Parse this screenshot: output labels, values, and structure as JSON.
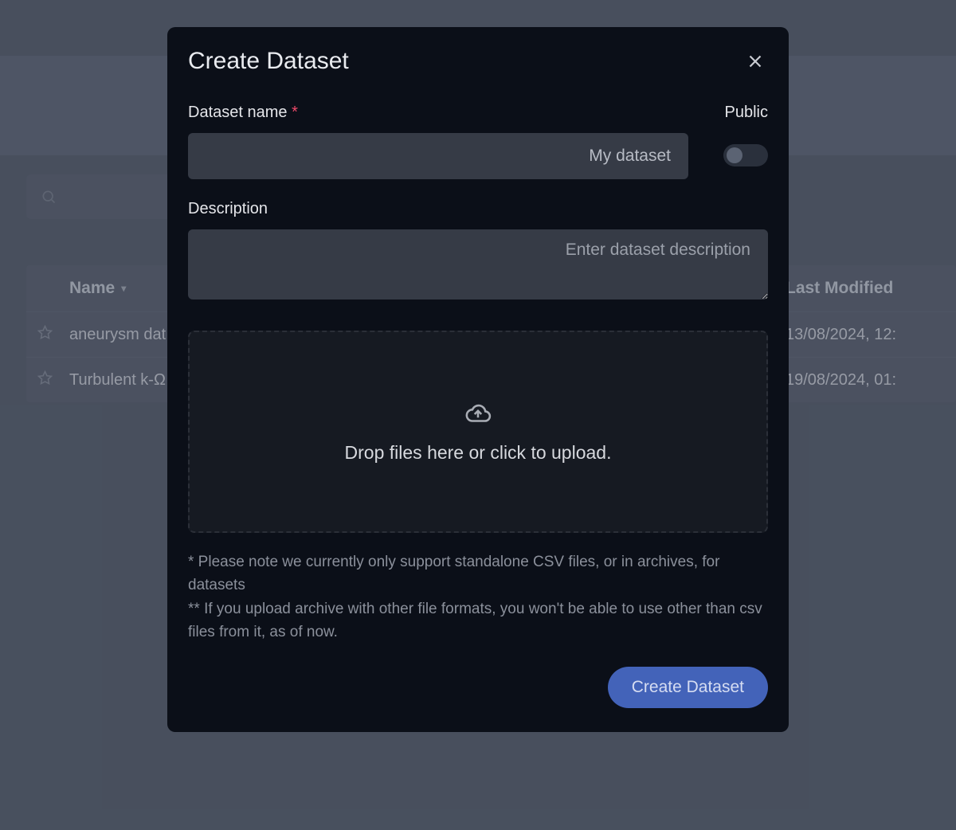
{
  "table": {
    "columns": {
      "name": "Name",
      "last_modified": "Last Modified"
    },
    "rows": [
      {
        "name": "aneurysm dat",
        "last_modified": "13/08/2024, 12:"
      },
      {
        "name": "Turbulent k-Ω",
        "last_modified": "19/08/2024, 01:"
      }
    ]
  },
  "modal": {
    "title": "Create Dataset",
    "fields": {
      "name_label": "Dataset name",
      "name_placeholder": "My dataset",
      "name_value": "",
      "public_label": "Public",
      "public_on": false,
      "desc_label": "Description",
      "desc_placeholder": "Enter dataset description",
      "desc_value": ""
    },
    "dropzone_text": "Drop files here or click to upload.",
    "note_line1": "* Please note we currently only support standalone CSV files, or in archives, for datasets",
    "note_line2": "** If you upload archive with other file formats, you won't be able to use other than csv files from it, as of now.",
    "submit_label": "Create Dataset"
  }
}
